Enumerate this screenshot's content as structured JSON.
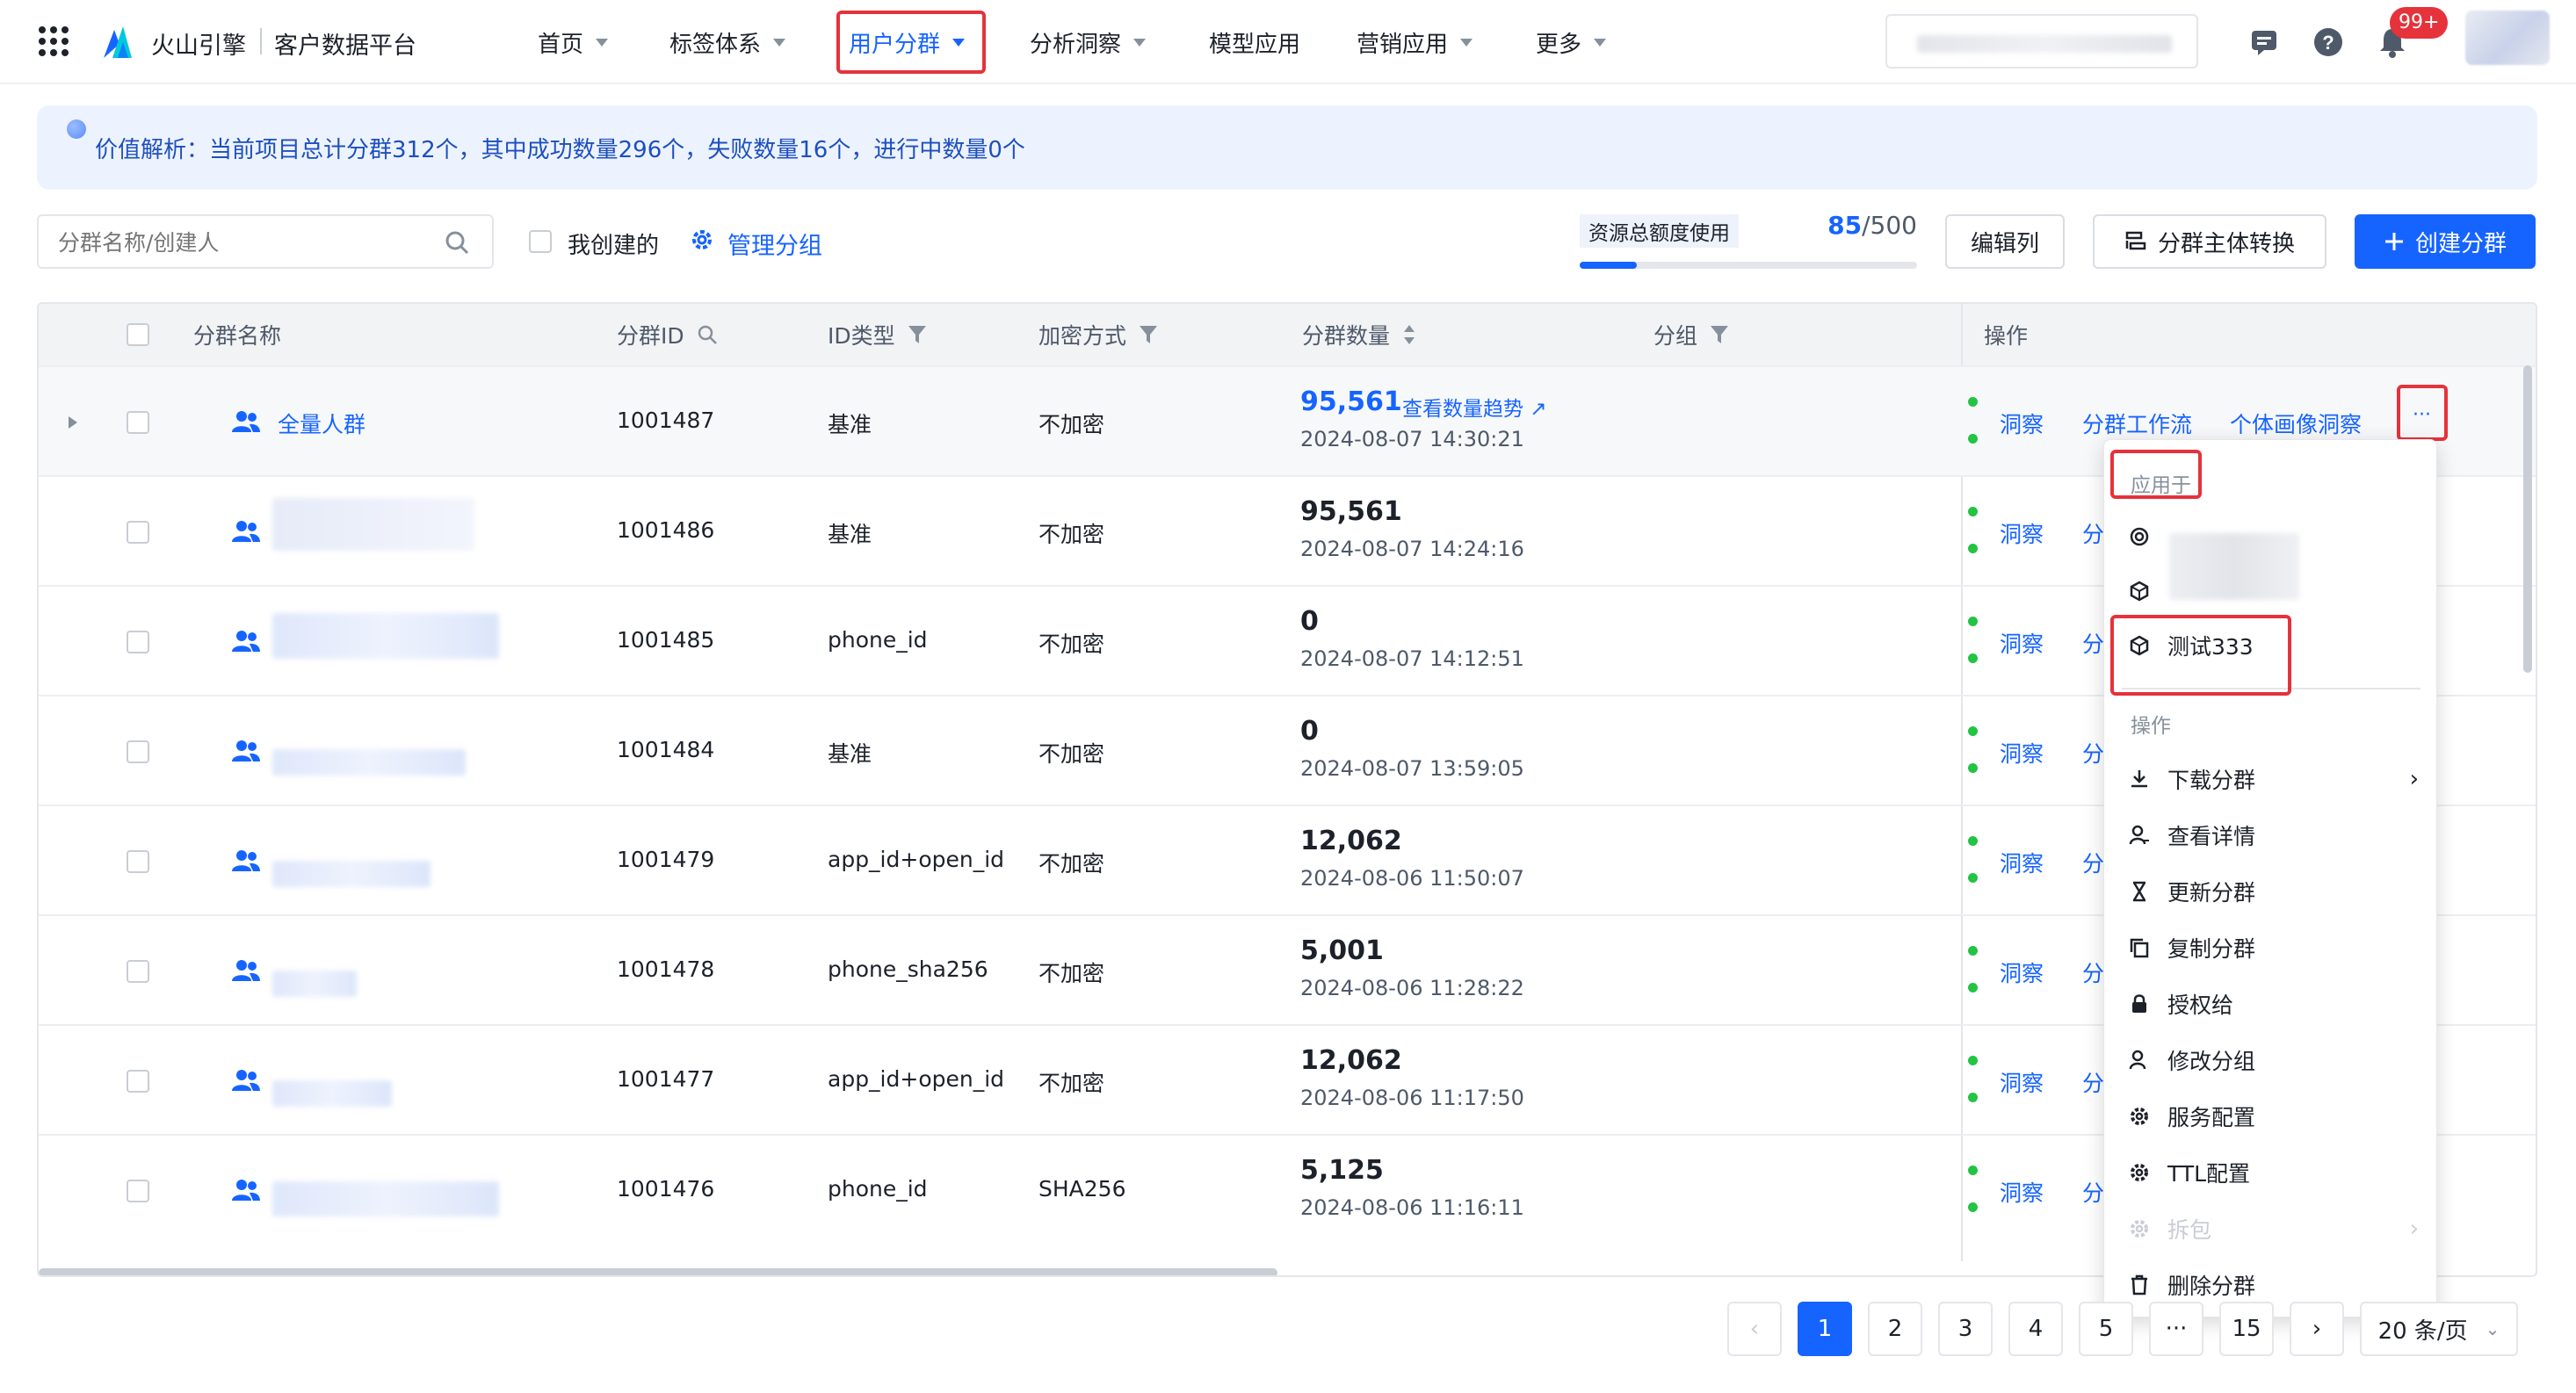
{
  "header": {
    "brand": "火山引擎",
    "product": "客户数据平台",
    "nav": [
      {
        "label": "首页",
        "caret": true
      },
      {
        "label": "标签体系",
        "caret": true
      },
      {
        "label": "用户分群",
        "caret": true,
        "active": true
      },
      {
        "label": "分析洞察",
        "caret": true
      },
      {
        "label": "模型应用",
        "caret": false
      },
      {
        "label": "营销应用",
        "caret": true
      },
      {
        "label": "更多",
        "caret": true
      }
    ],
    "notification_badge": "99+"
  },
  "banner": {
    "text": "价值解析：当前项目总计分群312个，其中成功数量296个，失败数量16个，进行中数量0个"
  },
  "toolbar": {
    "search_placeholder": "分群名称/创建人",
    "my_created": "我创建的",
    "manage_groups": "管理分组",
    "quota_label": "资源总额度使用",
    "quota_used": "85",
    "quota_total": "/500",
    "quota_fraction": 0.17,
    "edit_columns": "编辑列",
    "subject_convert": "分群主体转换",
    "create_segment": "创建分群"
  },
  "table": {
    "columns": {
      "name": "分群名称",
      "id": "分群ID",
      "id_type": "ID类型",
      "encryption": "加密方式",
      "count": "分群数量",
      "group": "分组",
      "actions": "操作"
    },
    "rows": [
      {
        "name": "全量人群",
        "id": "1001487",
        "id_type": "基准",
        "encryption": "不加密",
        "count": "95,561",
        "count_link": "查看数量趋势",
        "time": "2024-08-07 14:30:21"
      },
      {
        "name": "",
        "id": "1001486",
        "id_type": "基准",
        "encryption": "不加密",
        "count": "95,561",
        "time": "2024-08-07 14:24:16"
      },
      {
        "name": "",
        "id": "1001485",
        "id_type": "phone_id",
        "encryption": "不加密",
        "count": "0",
        "time": "2024-08-07 14:12:51"
      },
      {
        "name": "",
        "id": "1001484",
        "id_type": "基准",
        "encryption": "不加密",
        "count": "0",
        "time": "2024-08-07 13:59:05"
      },
      {
        "name": "",
        "id": "1001479",
        "id_type": "app_id+open_id",
        "encryption": "不加密",
        "count": "12,062",
        "time": "2024-08-06 11:50:07"
      },
      {
        "name": "",
        "id": "1001478",
        "id_type": "phone_sha256",
        "encryption": "不加密",
        "count": "5,001",
        "time": "2024-08-06 11:28:22"
      },
      {
        "name": "",
        "id": "1001477",
        "id_type": "app_id+open_id",
        "encryption": "不加密",
        "count": "12,062",
        "time": "2024-08-06 11:17:50"
      },
      {
        "name": "",
        "id": "1001476",
        "id_type": "phone_id",
        "encryption": "SHA256",
        "count": "5,125",
        "time": "2024-08-06 11:16:11"
      }
    ],
    "actions": {
      "insight": "洞察",
      "workflow": "分群工作流",
      "portrait": "个体画像洞察",
      "more": "···",
      "workflow_short": "分"
    }
  },
  "menu": {
    "section_apply": "应用于",
    "apply_items": [
      {
        "label": "测试333"
      }
    ],
    "section_ops": "操作",
    "ops": [
      {
        "label": "下载分群",
        "submenu": true
      },
      {
        "label": "查看详情"
      },
      {
        "label": "更新分群"
      },
      {
        "label": "复制分群"
      },
      {
        "label": "授权给"
      },
      {
        "label": "修改分组"
      },
      {
        "label": "服务配置"
      },
      {
        "label": "TTL配置"
      },
      {
        "label": "拆包",
        "disabled": true,
        "submenu": true
      },
      {
        "label": "删除分群"
      }
    ]
  },
  "pagination": {
    "pages": [
      "1",
      "2",
      "3",
      "4",
      "5"
    ],
    "ellipsis": "···",
    "last": "15",
    "page_size": "20 条/页",
    "current": "1"
  },
  "colors": {
    "primary": "#1664ff",
    "highlight": "#e5323b",
    "success": "#23c343"
  }
}
